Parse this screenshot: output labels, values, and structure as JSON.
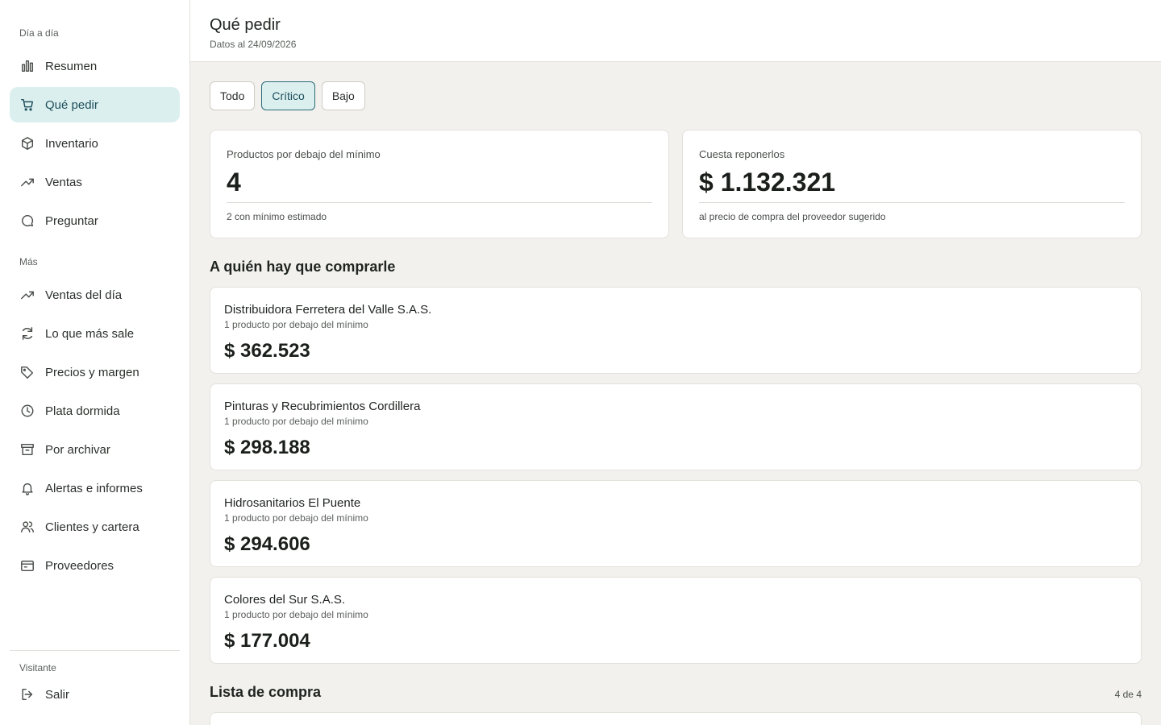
{
  "sidebar": {
    "section_daily": "Día a día",
    "section_more": "Más",
    "section_user": "Visitante",
    "items": [
      {
        "label": "Resumen",
        "icon": "bar-chart-icon"
      },
      {
        "label": "Qué pedir",
        "icon": "cart-icon"
      },
      {
        "label": "Inventario",
        "icon": "box-icon"
      },
      {
        "label": "Ventas",
        "icon": "trending-up-icon"
      },
      {
        "label": "Preguntar",
        "icon": "chat-icon"
      }
    ],
    "more_items": [
      {
        "label": "Ventas del día",
        "icon": "trending-up-icon"
      },
      {
        "label": "Lo que más sale",
        "icon": "refresh-icon"
      },
      {
        "label": "Precios y margen",
        "icon": "tag-icon"
      },
      {
        "label": "Plata dormida",
        "icon": "clock-icon"
      },
      {
        "label": "Por archivar",
        "icon": "archive-icon"
      },
      {
        "label": "Alertas e informes",
        "icon": "bell-icon"
      },
      {
        "label": "Clientes y cartera",
        "icon": "users-icon"
      },
      {
        "label": "Proveedores",
        "icon": "wallet-icon"
      }
    ],
    "logout": "Salir",
    "active_color": "#dcefef"
  },
  "header": {
    "title": "Qué pedir",
    "subtitle": "Datos al 24/09/2026"
  },
  "filters": [
    "Todo",
    "Crítico",
    "Bajo"
  ],
  "active_filter": "Crítico",
  "stats": [
    {
      "label": "Productos por debajo del mínimo",
      "value": "4",
      "note": "2 con mínimo estimado"
    },
    {
      "label": "Cuesta reponerlos",
      "value": "$ 1.132.321",
      "note": "al precio de compra del proveedor sugerido"
    }
  ],
  "suppliers_title": "A quién hay que comprarle",
  "suppliers": [
    {
      "name": "Distribuidora Ferretera del Valle S.A.S.",
      "sub": "1 producto por debajo del mínimo",
      "amount": "$ 362.523"
    },
    {
      "name": "Pinturas y Recubrimientos Cordillera",
      "sub": "1 producto por debajo del mínimo",
      "amount": "$ 298.188"
    },
    {
      "name": "Hidrosanitarios El Puente",
      "sub": "1 producto por debajo del mínimo",
      "amount": "$ 294.606"
    },
    {
      "name": "Colores del Sur S.A.S.",
      "sub": "1 producto por debajo del mínimo",
      "amount": "$ 177.004"
    }
  ],
  "list": {
    "title": "Lista de compra",
    "count": "4 de 4"
  }
}
